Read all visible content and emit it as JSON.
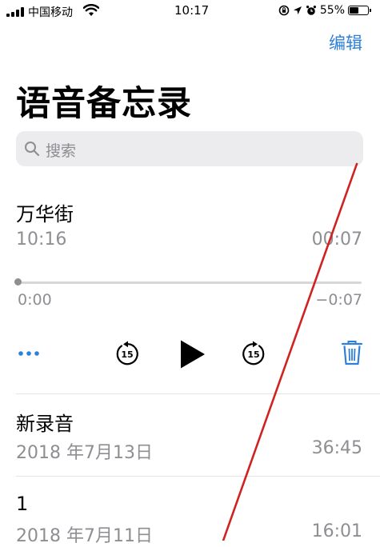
{
  "status_bar": {
    "carrier": "中国移动",
    "time": "10:17",
    "battery": "55%",
    "battery_level": 0.55
  },
  "nav": {
    "edit_label": "编辑"
  },
  "page_title": "语音备忘录",
  "search": {
    "placeholder": "搜索"
  },
  "expanded_recording": {
    "title": "万华街",
    "time": "10:16",
    "duration": "00:07",
    "elapsed": "0:00",
    "remaining": "−0:07",
    "skip_seconds": "15",
    "progress": 0
  },
  "recordings": [
    {
      "title": "新录音",
      "date": "2018 年7月13日",
      "duration": "36:45"
    },
    {
      "title": "1",
      "date": "2018 年7月11日",
      "duration": "16:01"
    }
  ],
  "colors": {
    "accent": "#2f80d7",
    "annotation_line": "#d0221f"
  }
}
